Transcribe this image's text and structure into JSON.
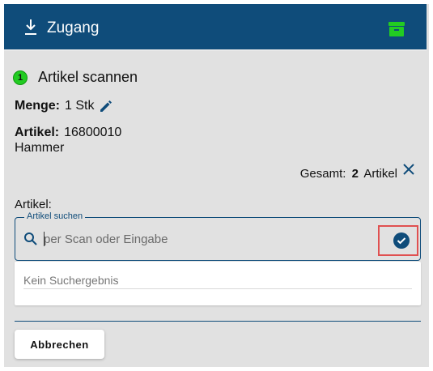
{
  "header": {
    "title": "Zugang",
    "left_icon": "download-icon",
    "right_icon": "archive-icon",
    "accent": "#0f4c7a",
    "archive_color": "#22cc22"
  },
  "step": {
    "number": "1",
    "label": "Artikel scannen",
    "badge_color": "#22cc22"
  },
  "menge": {
    "label": "Menge:",
    "value": "1 Stk",
    "icon": "pencil-icon"
  },
  "artikel": {
    "label": "Artikel:",
    "number": "16800010",
    "name": "Hammer"
  },
  "gesamt": {
    "prefix": "Gesamt:",
    "count": "2",
    "suffix": "Artikel",
    "icon": "close-icon"
  },
  "search": {
    "field_label": "Artikel:",
    "legend": "Artikel suchen",
    "placeholder": "per Scan oder Eingabe",
    "value": "",
    "confirm_icon": "check-circle-icon",
    "highlight_color": "#e05050"
  },
  "results": {
    "empty_text": "Kein Suchergebnis"
  },
  "actions": {
    "cancel_label": "Abbrechen"
  }
}
